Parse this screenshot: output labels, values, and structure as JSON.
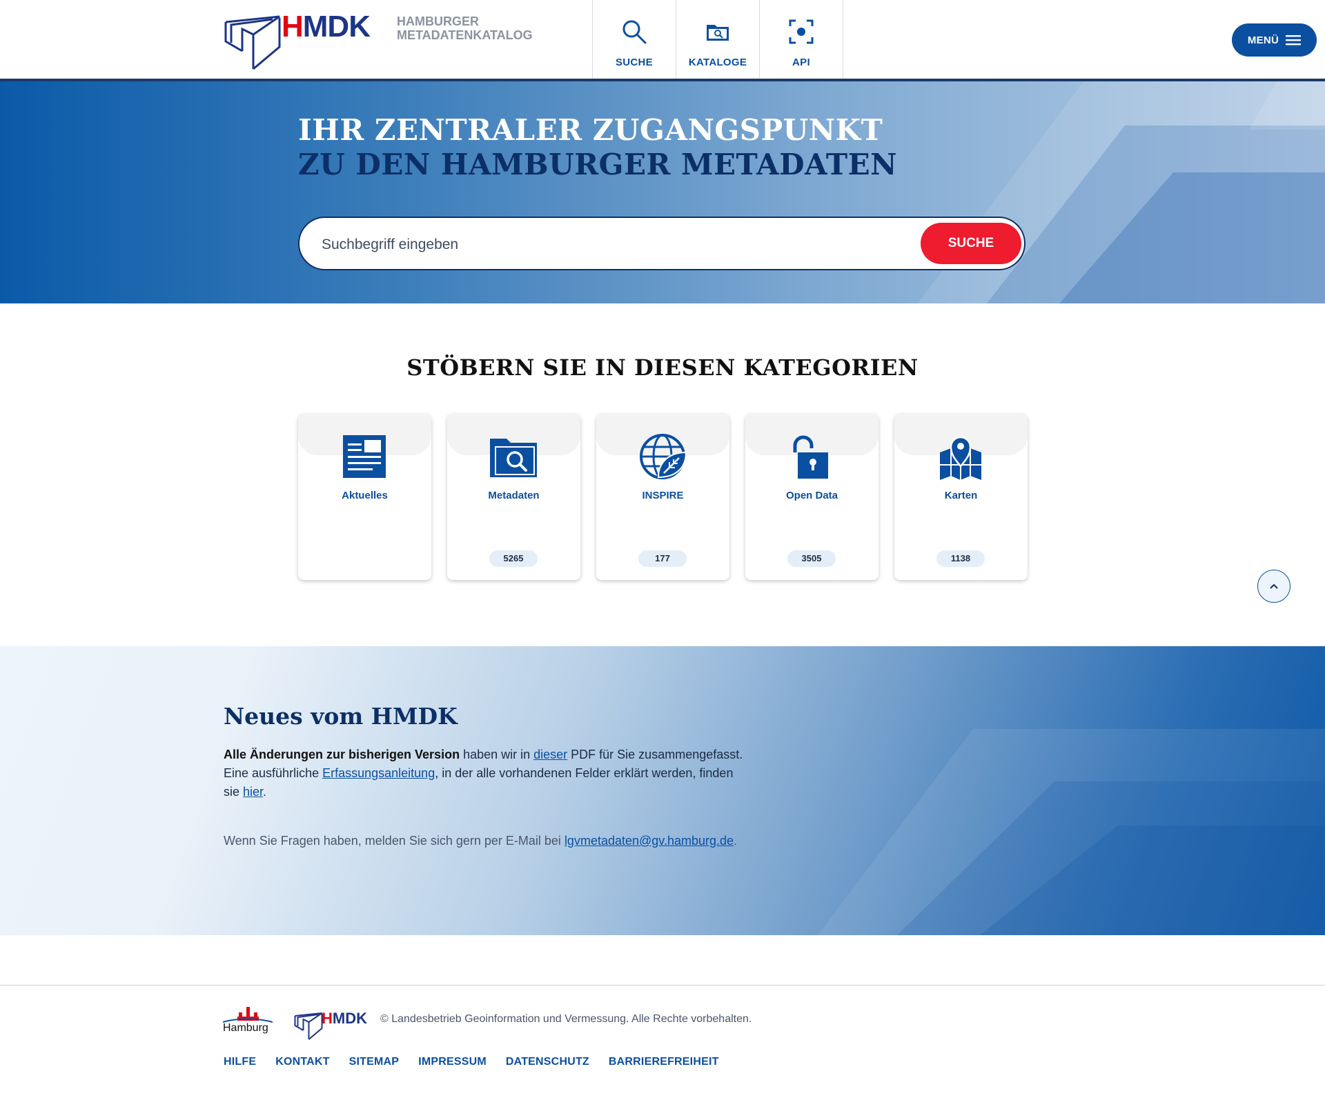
{
  "header": {
    "logo_h": "H",
    "logo_rest": "MDK",
    "logo_sub_line1": "HAMBURGER",
    "logo_sub_line2": "METADATENKATALOG",
    "nav": [
      {
        "label": "SUCHE",
        "icon": "search-icon"
      },
      {
        "label": "KATALOGE",
        "icon": "folder-search-icon"
      },
      {
        "label": "API",
        "icon": "api-focus-icon"
      }
    ],
    "menu_label": "MENÜ"
  },
  "hero": {
    "line1": "IHR ZENTRALER ZUGANGSPUNKT",
    "line2": "ZU DEN HAMBURGER METADATEN",
    "search_placeholder": "Suchbegriff eingeben",
    "search_button": "SUCHE"
  },
  "categories": {
    "title": "STÖBERN SIE IN DIESEN KATEGORIEN",
    "items": [
      {
        "label": "Aktuelles",
        "count": "",
        "icon": "news-icon"
      },
      {
        "label": "Metadaten",
        "count": "5265",
        "icon": "folder-search-icon"
      },
      {
        "label": "INSPIRE",
        "count": "177",
        "icon": "globe-leaf-icon"
      },
      {
        "label": "Open Data",
        "count": "3505",
        "icon": "unlocked-icon"
      },
      {
        "label": "Karten",
        "count": "1138",
        "icon": "map-pin-icon"
      }
    ]
  },
  "news": {
    "title": "Neues vom HMDK",
    "p1_bold": "Alle Änderungen zur bisherigen Version",
    "p1_text": " haben wir in ",
    "p1_link": "dieser",
    "p1_after": " PDF für Sie zusammengefasst.",
    "p2_text": "Eine ausführliche ",
    "p2_link": "Erfassungsanleitung",
    "p2_mid": ", in der alle vorhandenen Felder erklärt werden, finden sie ",
    "p2_link2": "hier",
    "p2_end": ".",
    "p3_text": "Wenn Sie Fragen haben, melden Sie sich gern per E-Mail bei ",
    "p3_link": "lgvmetadaten@gv.hamburg.de",
    "p3_end": "."
  },
  "footer": {
    "hamburg_label": "Hamburg",
    "logo_h": "H",
    "logo_rest": "MDK",
    "copyright": "© Landesbetrieb Geoinformation und Vermessung. Alle Rechte vorbehalten.",
    "links": [
      "HILFE",
      "KONTAKT",
      "SITEMAP",
      "IMPRESSUM",
      "DATENSCHUTZ",
      "BARRIEREFREIHEIT"
    ]
  },
  "colors": {
    "primary_blue": "#0b4fa0",
    "dark_navy": "#0b2f66",
    "accent_red": "#ef1b2e",
    "logo_red": "#e30613"
  }
}
